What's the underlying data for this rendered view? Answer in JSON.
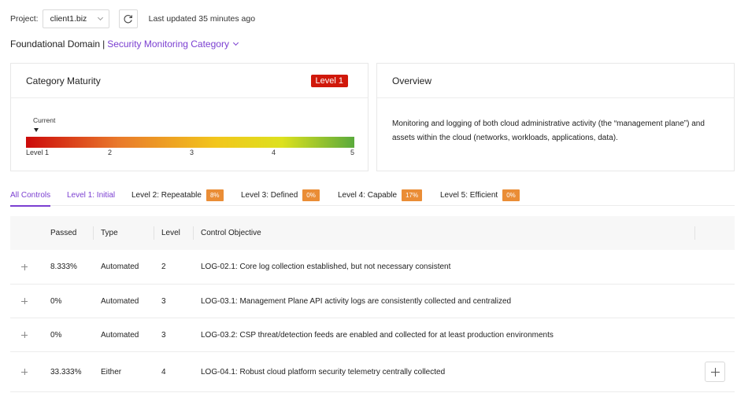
{
  "project": {
    "label": "Project:",
    "value": "client1.biz",
    "updated": "Last updated 35 minutes ago"
  },
  "breadcrumb": {
    "domain": "Foundational Domain",
    "separator": "|",
    "category": "Security Monitoring Category"
  },
  "maturity": {
    "title": "Category Maturity",
    "badge": "Level 1",
    "current_label": "Current",
    "current_level": 1,
    "scale": [
      "Level 1",
      "2",
      "3",
      "4",
      "5"
    ]
  },
  "overview": {
    "title": "Overview",
    "text": "Monitoring and logging of both cloud administrative activity (the “management plane”) and assets within the cloud (networks, workloads, applications, data)."
  },
  "tabs": [
    {
      "label": "All Controls"
    },
    {
      "label": "Level 1: Initial"
    },
    {
      "label": "Level 2: Repeatable",
      "pct": "8%"
    },
    {
      "label": "Level 3: Defined",
      "pct": "0%"
    },
    {
      "label": "Level 4: Capable",
      "pct": "17%"
    },
    {
      "label": "Level 5: Efficient",
      "pct": "0%"
    }
  ],
  "table": {
    "headers": [
      "Passed",
      "Type",
      "Level",
      "Control Objective"
    ],
    "rows": [
      {
        "passed": "8.333%",
        "type": "Automated",
        "level": "2",
        "objective": "LOG-02.1: Core log collection established, but not necessary consistent"
      },
      {
        "passed": "0%",
        "type": "Automated",
        "level": "3",
        "objective": "LOG-03.1: Management Plane API activity logs are consistently collected and centralized"
      },
      {
        "passed": "0%",
        "type": "Automated",
        "level": "3",
        "objective": "LOG-03.2: CSP threat/detection feeds are enabled and collected for at least production environments"
      },
      {
        "passed": "33.333%",
        "type": "Either",
        "level": "4",
        "objective": "LOG-04.1: Robust cloud platform security telemetry centrally collected"
      }
    ]
  },
  "colors": {
    "accent": "#7b3fd1",
    "badge_red": "#d0180a",
    "pct_orange": "#ea8d36"
  },
  "icons": {
    "refresh": "refresh-icon",
    "expand": "plus-icon",
    "dropdown": "chevron-down-icon"
  }
}
